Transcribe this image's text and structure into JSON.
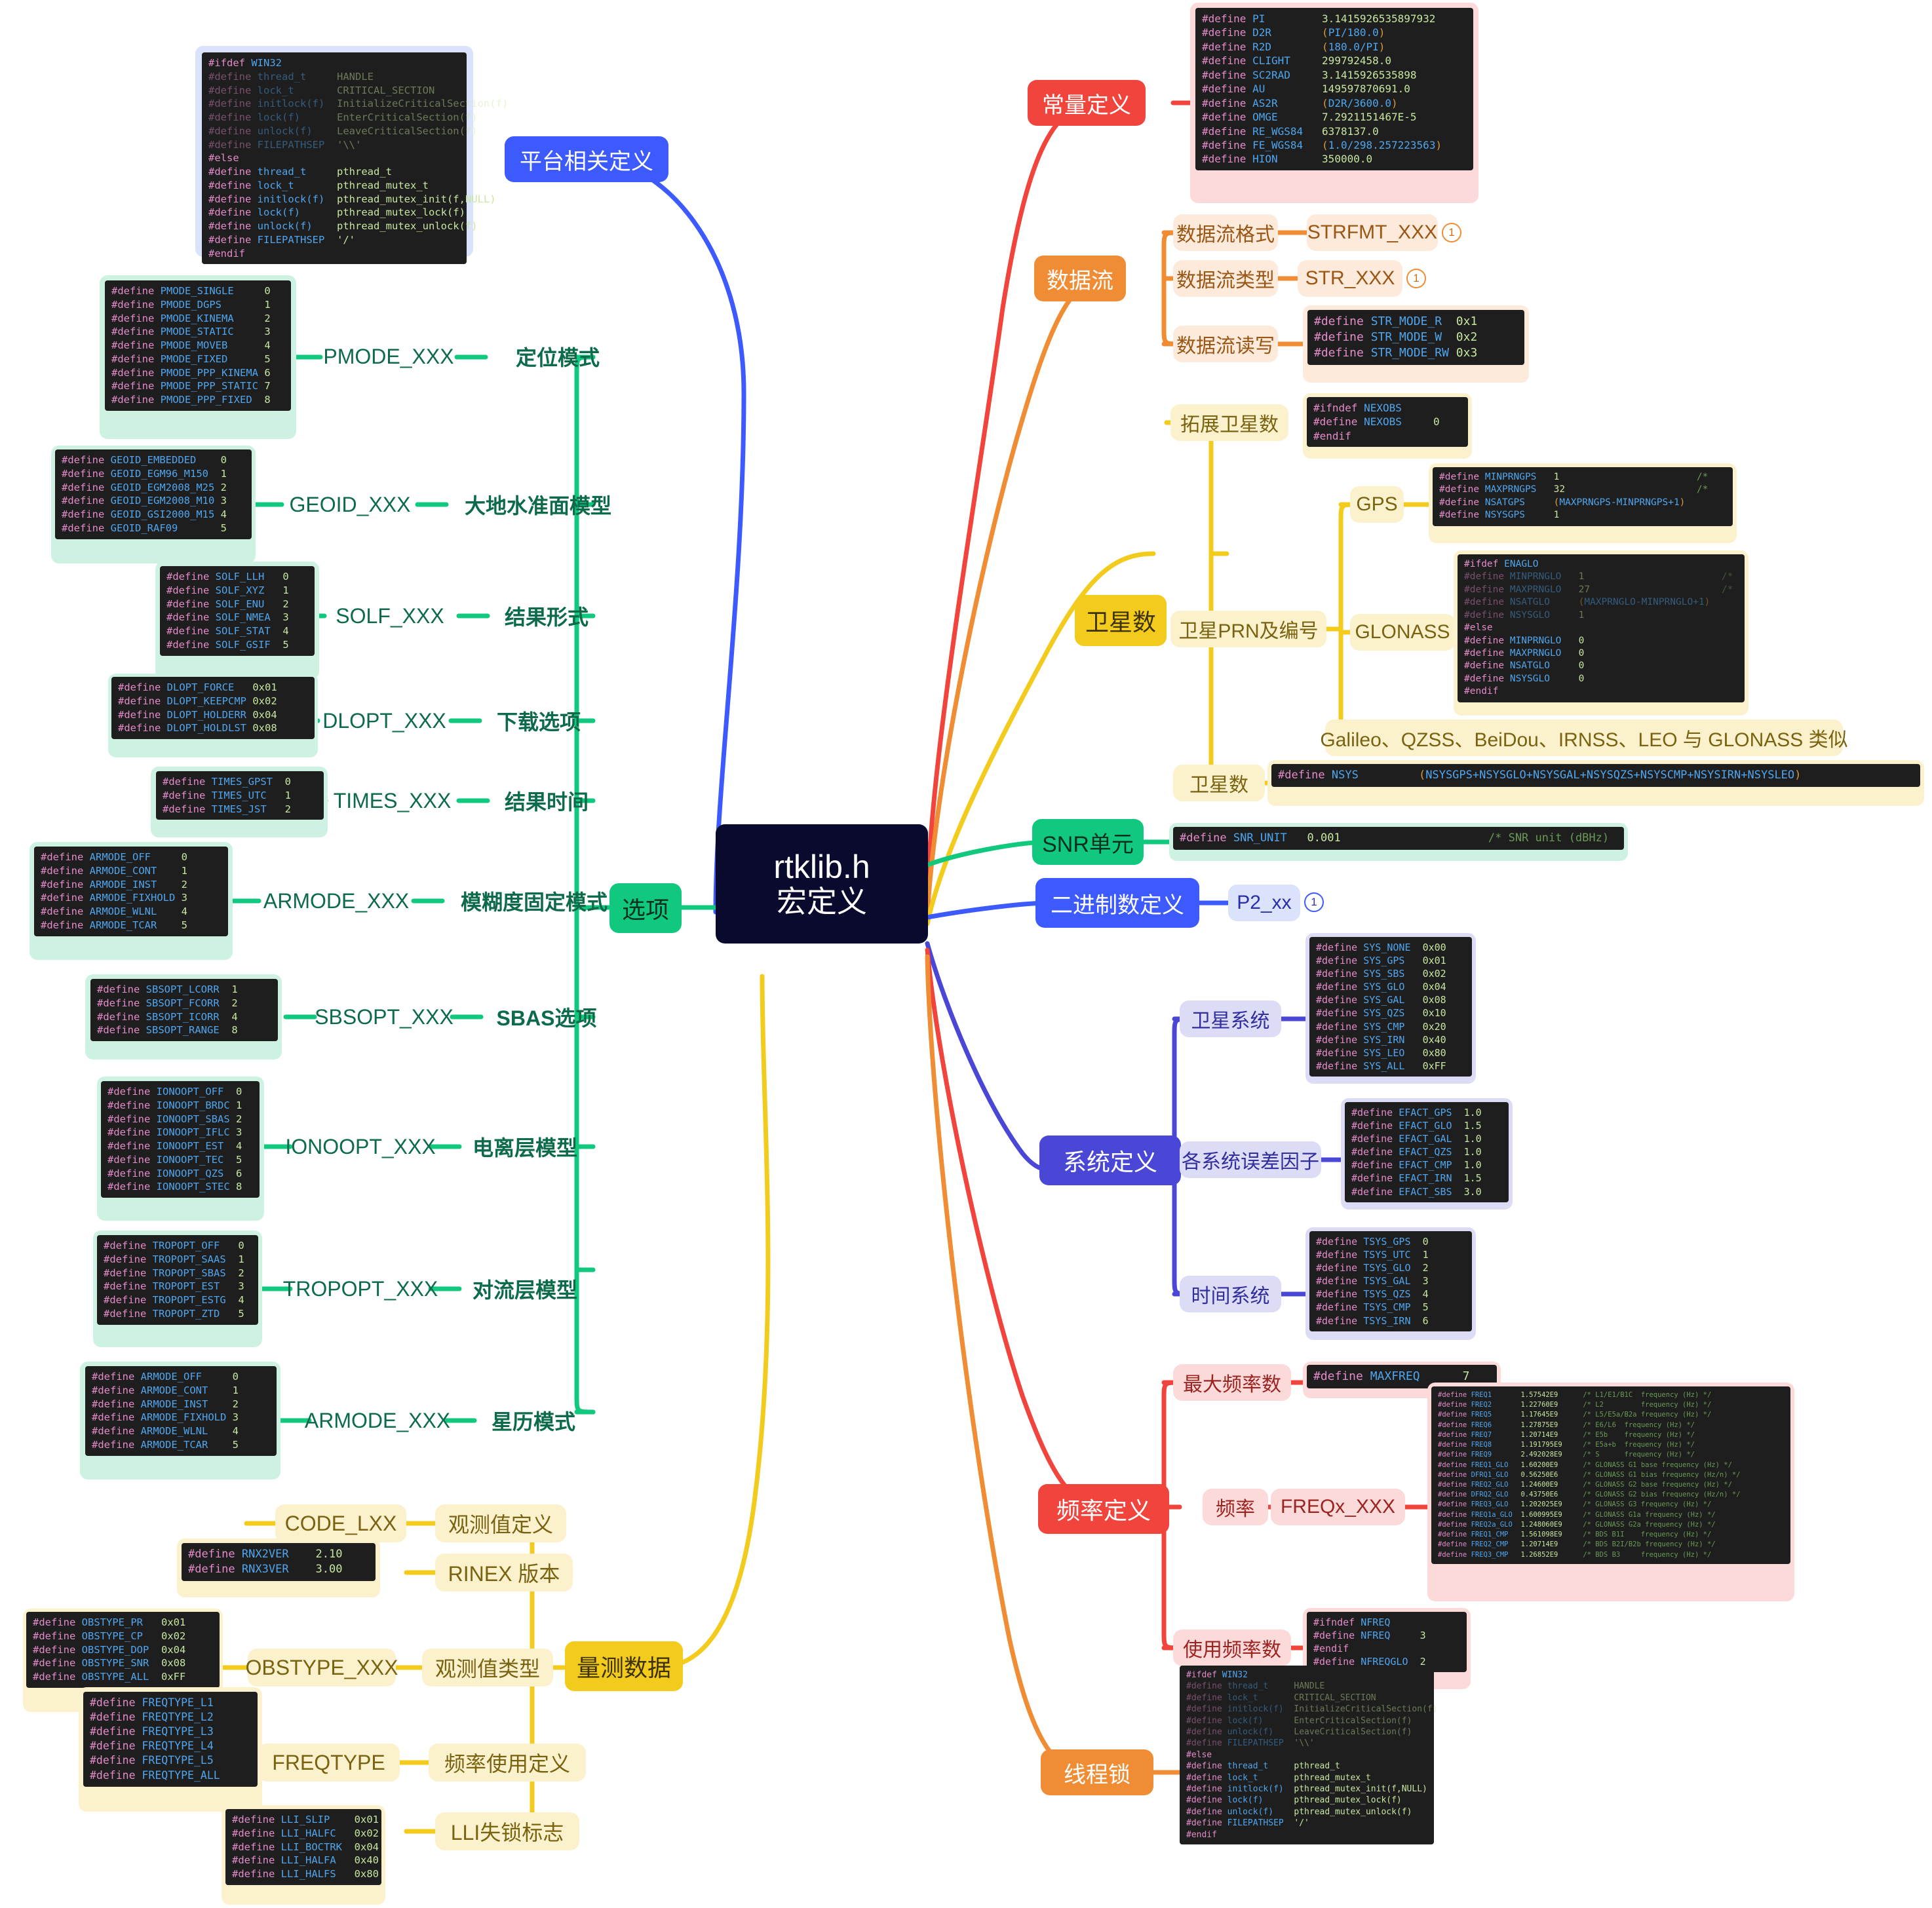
{
  "root": {
    "line1": "rtklib.h",
    "line2": "宏定义"
  },
  "branches": {
    "platform": {
      "label": "平台相关定义"
    },
    "options": {
      "label": "选项"
    },
    "constants": {
      "label": "常量定义"
    },
    "datastream": {
      "label": "数据流"
    },
    "satcount": {
      "label": "卫星数"
    },
    "snr": {
      "label": "SNR单元"
    },
    "binary": {
      "label": "二进制数定义"
    },
    "system": {
      "label": "系统定义"
    },
    "freq": {
      "label": "频率定义"
    },
    "threadlock": {
      "label": "线程锁"
    },
    "measure": {
      "label": "量测数据"
    }
  },
  "options_children": [
    {
      "name": "定位模式",
      "macro": "PMODE_XXX"
    },
    {
      "name": "大地水准面模型",
      "macro": "GEOID_XXX"
    },
    {
      "name": "结果形式",
      "macro": "SOLF_XXX"
    },
    {
      "name": "下载选项",
      "macro": "DLOPT_XXX"
    },
    {
      "name": "结果时间",
      "macro": "TIMES_XXX"
    },
    {
      "name": "模糊度固定模式",
      "macro": "ARMODE_XXX"
    },
    {
      "name": "SBAS选项",
      "macro": "SBSOPT_XXX"
    },
    {
      "name": "电离层模型",
      "macro": "IONOOPT_XXX"
    },
    {
      "name": "对流层模型",
      "macro": "TROPOPT_XXX"
    },
    {
      "name": "星历模式",
      "macro": "ARMODE_XXX"
    }
  ],
  "datastream_children": [
    {
      "name": "数据流格式",
      "macro": "STRFMT_XXX",
      "badge": "1"
    },
    {
      "name": "数据流类型",
      "macro": "STR_XXX",
      "badge": "1"
    },
    {
      "name": "数据流读写",
      "macro": ""
    }
  ],
  "satcount_children": [
    {
      "name": "拓展卫星数"
    },
    {
      "name": "卫星PRN及编号"
    },
    {
      "name": "卫星数"
    }
  ],
  "prn_children": [
    {
      "name": "GPS"
    },
    {
      "name": "GLONASS"
    },
    {
      "name": "Galileo、QZSS、BeiDou、IRNSS、LEO 与 GLONASS 类似"
    }
  ],
  "binary_children": [
    {
      "name": "P2_xx",
      "badge": "1"
    }
  ],
  "system_children": [
    {
      "name": "卫星系统"
    },
    {
      "name": "各系统误差因子"
    },
    {
      "name": "时间系统"
    }
  ],
  "freq_children": [
    {
      "name": "最大频率数"
    },
    {
      "name": "频率",
      "macro": "FREQx_XXX"
    },
    {
      "name": "使用频率数"
    }
  ],
  "measure_children": [
    {
      "name": "观测值定义",
      "macro": "CODE_LXX"
    },
    {
      "name": "RINEX 版本",
      "macro": ""
    },
    {
      "name": "观测值类型",
      "macro": "OBSTYPE_XXX"
    },
    {
      "name": "频率使用定义",
      "macro": "FREQTYPE"
    },
    {
      "name": "LLI失锁标志",
      "macro": ""
    }
  ],
  "code": {
    "platform": [
      [
        "#ifdef",
        "WIN32",
        "",
        ""
      ],
      [
        "#define",
        "thread_t",
        "HANDLE",
        ""
      ],
      [
        "#define",
        "lock_t",
        "CRITICAL_SECTION",
        ""
      ],
      [
        "#define",
        "initlock(f)",
        "InitializeCriticalSection(f)",
        ""
      ],
      [
        "#define",
        "lock(f)",
        "EnterCriticalSection(f)",
        ""
      ],
      [
        "#define",
        "unlock(f)",
        "LeaveCriticalSection(f)",
        ""
      ],
      [
        "#define",
        "FILEPATHSEP",
        "'\\\\'",
        ""
      ],
      [
        "#else",
        "",
        "",
        ""
      ],
      [
        "#define",
        "thread_t",
        "pthread_t",
        ""
      ],
      [
        "#define",
        "lock_t",
        "pthread_mutex_t",
        ""
      ],
      [
        "#define",
        "initlock(f)",
        "pthread_mutex_init(f,NULL)",
        ""
      ],
      [
        "#define",
        "lock(f)",
        "pthread_mutex_lock(f)",
        ""
      ],
      [
        "#define",
        "unlock(f)",
        "pthread_mutex_unlock(f)",
        ""
      ],
      [
        "#define",
        "FILEPATHSEP",
        "'/'",
        ""
      ],
      [
        "#endif",
        "",
        "",
        ""
      ]
    ],
    "constants": [
      [
        "#define",
        "PI",
        "3.1415926535897932"
      ],
      [
        "#define",
        "D2R",
        "(PI/180.0)"
      ],
      [
        "#define",
        "R2D",
        "(180.0/PI)"
      ],
      [
        "#define",
        "CLIGHT",
        "299792458.0"
      ],
      [
        "#define",
        "SC2RAD",
        "3.1415926535898"
      ],
      [
        "#define",
        "AU",
        "149597870691.0"
      ],
      [
        "#define",
        "AS2R",
        "(D2R/3600.0)"
      ],
      [
        "#define",
        "OMGE",
        "7.2921151467E-5"
      ],
      [
        "#define",
        "RE_WGS84",
        "6378137.0"
      ],
      [
        "#define",
        "FE_WGS84",
        "(1.0/298.257223563)"
      ],
      [
        "#define",
        "HION",
        "350000.0"
      ]
    ],
    "str_mode": [
      [
        "#define",
        "STR_MODE_R",
        "0x1"
      ],
      [
        "#define",
        "STR_MODE_W",
        "0x2"
      ],
      [
        "#define",
        "STR_MODE_RW",
        "0x3"
      ]
    ],
    "nexobs": [
      [
        "#ifndef",
        "NEXOBS",
        ""
      ],
      [
        "#define",
        "NEXOBS",
        "0"
      ],
      [
        "#endif",
        "",
        ""
      ]
    ],
    "gps": [
      [
        "#define",
        "MINPRNGPS",
        "1",
        "/* "
      ],
      [
        "#define",
        "MAXPRNGPS",
        "32",
        "/* "
      ],
      [
        "#define",
        "NSATGPS",
        "(MAXPRNGPS-MINPRNGPS+1)",
        ""
      ],
      [
        "#define",
        "NSYSGPS",
        "1",
        ""
      ]
    ],
    "glonass": [
      [
        "#ifdef",
        "ENAGLO",
        "",
        ""
      ],
      [
        "#define",
        "MINPRNGLO",
        "1",
        "/* "
      ],
      [
        "#define",
        "MAXPRNGLO",
        "27",
        "/* "
      ],
      [
        "#define",
        "NSATGLO",
        "(MAXPRNGLO-MINPRNGLO+1)",
        ""
      ],
      [
        "#define",
        "NSYSGLO",
        "1",
        ""
      ],
      [
        "#else",
        "",
        "",
        ""
      ],
      [
        "#define",
        "MINPRNGLO",
        "0",
        ""
      ],
      [
        "#define",
        "MAXPRNGLO",
        "0",
        ""
      ],
      [
        "#define",
        "NSATGLO",
        "0",
        ""
      ],
      [
        "#define",
        "NSYSGLO",
        "0",
        ""
      ],
      [
        "#endif",
        "",
        "",
        ""
      ]
    ],
    "nsys": [
      [
        "#define",
        "NSYS",
        "(NSYSGPS+NSYSGLO+NSYSGAL+NSYSQZS+NSYSCMP+NSYSIRN+NSYSLEO)"
      ]
    ],
    "snr_unit": [
      [
        "#define",
        "SNR_UNIT",
        "0.001",
        "/* SNR unit (dBHz)"
      ]
    ],
    "pmode": [
      [
        "#define",
        "PMODE_SINGLE",
        "0"
      ],
      [
        "#define",
        "PMODE_DGPS",
        "1"
      ],
      [
        "#define",
        "PMODE_KINEMA",
        "2"
      ],
      [
        "#define",
        "PMODE_STATIC",
        "3"
      ],
      [
        "#define",
        "PMODE_MOVEB",
        "4"
      ],
      [
        "#define",
        "PMODE_FIXED",
        "5"
      ],
      [
        "#define",
        "PMODE_PPP_KINEMA",
        "6"
      ],
      [
        "#define",
        "PMODE_PPP_STATIC",
        "7"
      ],
      [
        "#define",
        "PMODE_PPP_FIXED",
        "8"
      ]
    ],
    "geoid": [
      [
        "#define",
        "GEOID_EMBEDDED",
        "0"
      ],
      [
        "#define",
        "GEOID_EGM96_M150",
        "1"
      ],
      [
        "#define",
        "GEOID_EGM2008_M25",
        "2"
      ],
      [
        "#define",
        "GEOID_EGM2008_M10",
        "3"
      ],
      [
        "#define",
        "GEOID_GSI2000_M15",
        "4"
      ],
      [
        "#define",
        "GEOID_RAF09",
        "5"
      ]
    ],
    "solf": [
      [
        "#define",
        "SOLF_LLH",
        "0"
      ],
      [
        "#define",
        "SOLF_XYZ",
        "1"
      ],
      [
        "#define",
        "SOLF_ENU",
        "2"
      ],
      [
        "#define",
        "SOLF_NMEA",
        "3"
      ],
      [
        "#define",
        "SOLF_STAT",
        "4"
      ],
      [
        "#define",
        "SOLF_GSIF",
        "5"
      ]
    ],
    "dlopt": [
      [
        "#define",
        "DLOPT_FORCE",
        "0x01"
      ],
      [
        "#define",
        "DLOPT_KEEPCMP",
        "0x02"
      ],
      [
        "#define",
        "DLOPT_HOLDERR",
        "0x04"
      ],
      [
        "#define",
        "DLOPT_HOLDLST",
        "0x08"
      ]
    ],
    "times": [
      [
        "#define",
        "TIMES_GPST",
        "0"
      ],
      [
        "#define",
        "TIMES_UTC",
        "1"
      ],
      [
        "#define",
        "TIMES_JST",
        "2"
      ]
    ],
    "armode": [
      [
        "#define",
        "ARMODE_OFF",
        "0"
      ],
      [
        "#define",
        "ARMODE_CONT",
        "1"
      ],
      [
        "#define",
        "ARMODE_INST",
        "2"
      ],
      [
        "#define",
        "ARMODE_FIXHOLD",
        "3"
      ],
      [
        "#define",
        "ARMODE_WLNL",
        "4"
      ],
      [
        "#define",
        "ARMODE_TCAR",
        "5"
      ]
    ],
    "sbsopt": [
      [
        "#define",
        "SBSOPT_LCORR",
        "1"
      ],
      [
        "#define",
        "SBSOPT_FCORR",
        "2"
      ],
      [
        "#define",
        "SBSOPT_ICORR",
        "4"
      ],
      [
        "#define",
        "SBSOPT_RANGE",
        "8"
      ]
    ],
    "ionoopt": [
      [
        "#define",
        "IONOOPT_OFF",
        "0"
      ],
      [
        "#define",
        "IONOOPT_BRDC",
        "1"
      ],
      [
        "#define",
        "IONOOPT_SBAS",
        "2"
      ],
      [
        "#define",
        "IONOOPT_IFLC",
        "3"
      ],
      [
        "#define",
        "IONOOPT_EST",
        "4"
      ],
      [
        "#define",
        "IONOOPT_TEC",
        "5"
      ],
      [
        "#define",
        "IONOOPT_QZS",
        "6"
      ],
      [
        "#define",
        "IONOOPT_STEC",
        "8"
      ]
    ],
    "tropopt": [
      [
        "#define",
        "TROPOPT_OFF",
        "0"
      ],
      [
        "#define",
        "TROPOPT_SAAS",
        "1"
      ],
      [
        "#define",
        "TROPOPT_SBAS",
        "2"
      ],
      [
        "#define",
        "TROPOPT_EST",
        "3"
      ],
      [
        "#define",
        "TROPOPT_ESTG",
        "4"
      ],
      [
        "#define",
        "TROPOPT_ZTD",
        "5"
      ]
    ],
    "sys": [
      [
        "#define",
        "SYS_NONE",
        "0x00"
      ],
      [
        "#define",
        "SYS_GPS",
        "0x01"
      ],
      [
        "#define",
        "SYS_SBS",
        "0x02"
      ],
      [
        "#define",
        "SYS_GLO",
        "0x04"
      ],
      [
        "#define",
        "SYS_GAL",
        "0x08"
      ],
      [
        "#define",
        "SYS_QZS",
        "0x10"
      ],
      [
        "#define",
        "SYS_CMP",
        "0x20"
      ],
      [
        "#define",
        "SYS_IRN",
        "0x40"
      ],
      [
        "#define",
        "SYS_LEO",
        "0x80"
      ],
      [
        "#define",
        "SYS_ALL",
        "0xFF"
      ]
    ],
    "efact": [
      [
        "#define",
        "EFACT_GPS",
        "1.0"
      ],
      [
        "#define",
        "EFACT_GLO",
        "1.5"
      ],
      [
        "#define",
        "EFACT_GAL",
        "1.0"
      ],
      [
        "#define",
        "EFACT_QZS",
        "1.0"
      ],
      [
        "#define",
        "EFACT_CMP",
        "1.0"
      ],
      [
        "#define",
        "EFACT_IRN",
        "1.5"
      ],
      [
        "#define",
        "EFACT_SBS",
        "3.0"
      ]
    ],
    "tsys": [
      [
        "#define",
        "TSYS_GPS",
        "0"
      ],
      [
        "#define",
        "TSYS_UTC",
        "1"
      ],
      [
        "#define",
        "TSYS_GLO",
        "2"
      ],
      [
        "#define",
        "TSYS_GAL",
        "3"
      ],
      [
        "#define",
        "TSYS_QZS",
        "4"
      ],
      [
        "#define",
        "TSYS_CMP",
        "5"
      ],
      [
        "#define",
        "TSYS_IRN",
        "6"
      ]
    ],
    "maxfreq": [
      [
        "#define",
        "MAXFREQ",
        "7"
      ]
    ],
    "freqs": [
      [
        "#define",
        "FREQ1",
        "1.57542E9",
        "/* L1/E1/B1C  frequency (Hz) */"
      ],
      [
        "#define",
        "FREQ2",
        "1.22760E9",
        "/* L2         frequency (Hz) */"
      ],
      [
        "#define",
        "FREQ5",
        "1.17645E9",
        "/* L5/E5a/B2a frequency (Hz) */"
      ],
      [
        "#define",
        "FREQ6",
        "1.27875E9",
        "/* E6/L6  frequency (Hz) */"
      ],
      [
        "#define",
        "FREQ7",
        "1.20714E9",
        "/* E5b    frequency (Hz) */"
      ],
      [
        "#define",
        "FREQ8",
        "1.191795E9",
        "/* E5a+b  frequency (Hz) */"
      ],
      [
        "#define",
        "FREQ9",
        "2.492028E9",
        "/* S      frequency (Hz) */"
      ],
      [
        "#define",
        "FREQ1_GLO",
        "1.60200E9",
        "/* GLONASS G1 base frequency (Hz) */"
      ],
      [
        "#define",
        "DFRQ1_GLO",
        "0.56250E6",
        "/* GLONASS G1 bias frequency (Hz/n) */"
      ],
      [
        "#define",
        "FREQ2_GLO",
        "1.24600E9",
        "/* GLONASS G2 base frequency (Hz) */"
      ],
      [
        "#define",
        "DFRQ2_GLO",
        "0.43750E6",
        "/* GLONASS G2 bias frequency (Hz/n) */"
      ],
      [
        "#define",
        "FREQ3_GLO",
        "1.202025E9",
        "/* GLONASS G3 frequency (Hz) */"
      ],
      [
        "#define",
        "FREQ1a_GLO",
        "1.600995E9",
        "/* GLONASS G1a frequency (Hz) */"
      ],
      [
        "#define",
        "FREQ2a_GLO",
        "1.248060E9",
        "/* GLONASS G2a frequency (Hz) */"
      ],
      [
        "#define",
        "FREQ1_CMP",
        "1.561098E9",
        "/* BDS B1I    frequency (Hz) */"
      ],
      [
        "#define",
        "FREQ2_CMP",
        "1.20714E9",
        "/* BDS B2I/B2b frequency (Hz) */"
      ],
      [
        "#define",
        "FREQ3_CMP",
        "1.26852E9",
        "/* BDS B3     frequency (Hz) */"
      ]
    ],
    "nfreq": [
      [
        "#ifndef",
        "NFREQ",
        ""
      ],
      [
        "#define",
        "NFREQ",
        "3"
      ],
      [
        "#endif",
        "",
        ""
      ],
      [
        "#define",
        "NFREQGLO",
        "2"
      ]
    ],
    "rnxver": [
      [
        "#define",
        "RNX2VER",
        "2.10"
      ],
      [
        "#define",
        "RNX3VER",
        "3.00"
      ]
    ],
    "obstype": [
      [
        "#define",
        "OBSTYPE_PR",
        "0x01"
      ],
      [
        "#define",
        "OBSTYPE_CP",
        "0x02"
      ],
      [
        "#define",
        "OBSTYPE_DOP",
        "0x04"
      ],
      [
        "#define",
        "OBSTYPE_SNR",
        "0x08"
      ],
      [
        "#define",
        "OBSTYPE_ALL",
        "0xFF"
      ]
    ],
    "freqtype": [
      [
        "#define",
        "FREQTYPE_L1",
        ""
      ],
      [
        "#define",
        "FREQTYPE_L2",
        ""
      ],
      [
        "#define",
        "FREQTYPE_L3",
        ""
      ],
      [
        "#define",
        "FREQTYPE_L4",
        ""
      ],
      [
        "#define",
        "FREQTYPE_L5",
        ""
      ],
      [
        "#define",
        "FREQTYPE_ALL",
        ""
      ]
    ],
    "lli": [
      [
        "#define",
        "LLI_SLIP",
        "0x01"
      ],
      [
        "#define",
        "LLI_HALFC",
        "0x02"
      ],
      [
        "#define",
        "LLI_BOCTRK",
        "0x04"
      ],
      [
        "#define",
        "LLI_HALFA",
        "0x40"
      ],
      [
        "#define",
        "LLI_HALFS",
        "0x80"
      ]
    ]
  },
  "colors": {
    "green": "#11c97e",
    "blue": "#3d5afe",
    "purple": "#4a46d6",
    "red": "#f0443d",
    "orange": "#f08c33",
    "yellow": "#f2cb1d",
    "root_bg": "#0a0a2e",
    "code_bg": "#1e1e1e"
  }
}
